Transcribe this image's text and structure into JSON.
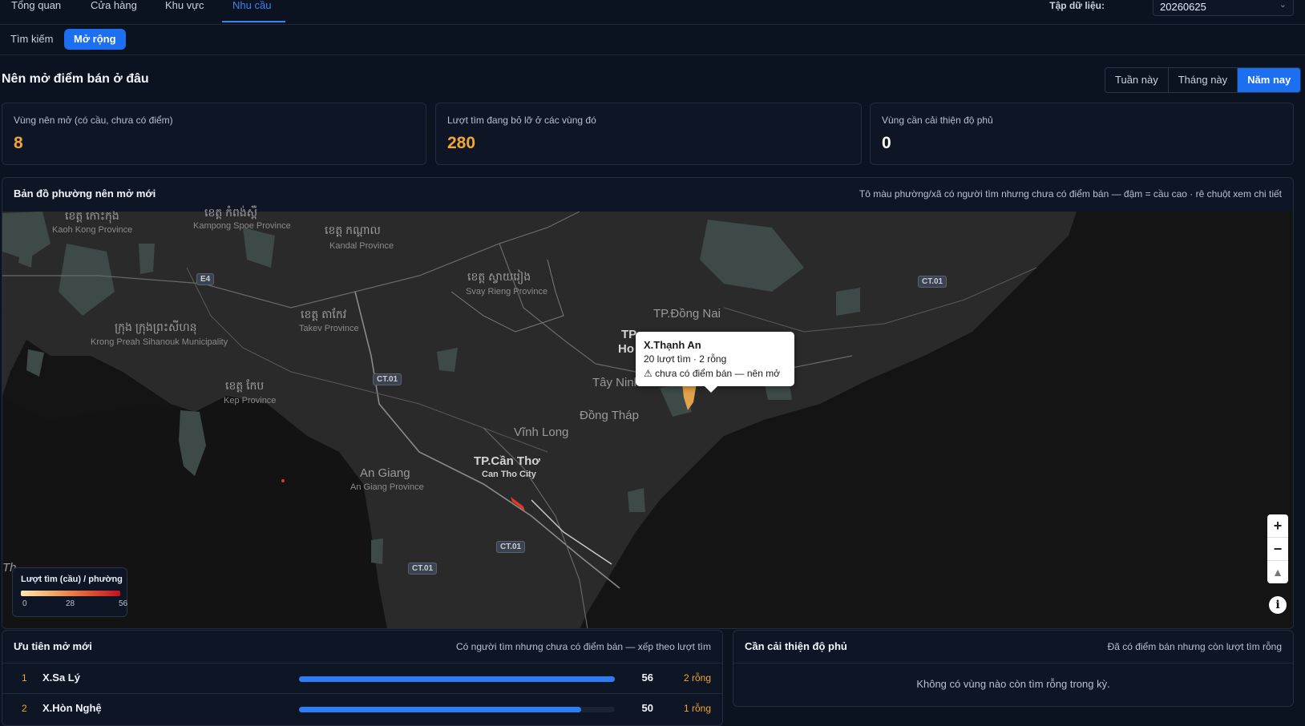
{
  "nav": {
    "tabs": [
      "Tổng quan",
      "Cửa hàng",
      "Khu vực",
      "Nhu cầu"
    ],
    "active_tab": "Nhu cầu",
    "dataset_label": "Tập dữ liệu:",
    "dataset_value": "20260625"
  },
  "subnav": {
    "tabs": [
      "Tìm kiếm",
      "Mở rộng"
    ],
    "active": "Mở rộng"
  },
  "page": {
    "title": "Nên mở điểm bán ở đâu"
  },
  "period": {
    "options": [
      "Tuần này",
      "Tháng này",
      "Năm nay"
    ],
    "active": "Năm nay"
  },
  "kpis": [
    {
      "label": "Vùng nên mở (có cầu, chưa có điểm)",
      "value": "8",
      "color": "#f0a535"
    },
    {
      "label": "Lượt tìm đang bỏ lỡ ở các vùng đó",
      "value": "280",
      "color": "#f0a535"
    },
    {
      "label": "Vùng cần cải thiện độ phủ",
      "value": "0",
      "color": "#ffffff"
    }
  ],
  "map": {
    "title": "Bản đồ phường nên mở mới",
    "hint": "Tô màu phường/xã có người tìm nhưng chưa có điểm bán — đậm = cầu cao · rê chuột xem chi tiết",
    "labels": {
      "kaoh_kong_km": "ខេត្ត កោះកុង",
      "kaoh_kong": "Kaoh Kong Province",
      "kampong_spoe_km": "ខេត្ត កំពង់ស្ពឺ",
      "kampong_spoe": "Kampong Spoe Province",
      "kandal_km": "ខេត្ត កណ្តាល",
      "kandal": "Kandal Province",
      "svay_rieng_km": "ខេត្ត ស្វាយរៀង",
      "svay_rieng": "Svay Rieng Province",
      "takeo_km": "ខេត្ត តាកែវ",
      "takeo": "Takev Province",
      "sihanouk_km": "ក្រុង ក្រុងព្រះសីហនុ",
      "sihanouk": "Krong Preah Sihanouk Municipality",
      "kep_km": "ខេត្ត កែប",
      "kep": "Kep Province",
      "dong_nai": "TP.Đồng Nai",
      "tp_partial": "TP",
      "ho_partial": "Ho",
      "tay_ninh": "Tây Ninh",
      "dong_thap": "Đồng Tháp",
      "vinh_long": "Vĩnh Long",
      "can_tho": "TP.Cần Thơ",
      "can_tho_en": "Can Tho City",
      "an_giang": "An Giang",
      "an_giang_en": "An Giang Province",
      "th_partial": "Th"
    },
    "shields": [
      "E4",
      "CT.01",
      "CT.01",
      "CT.01",
      "CT.01"
    ],
    "tooltip": {
      "name": "X.Thạnh An",
      "stats": "20 lượt tìm · 2 rỗng",
      "note": "⚠ chưa có điểm bán — nên mở"
    },
    "legend": {
      "title": "Lượt tìm (cầu) / phường",
      "min": "0",
      "mid": "28",
      "max": "56"
    },
    "controls": {
      "zoom_in": "+",
      "zoom_out": "−",
      "compass": "▲",
      "info": "i"
    }
  },
  "priority": {
    "title": "Ưu tiên mở mới",
    "hint": "Có người tìm nhưng chưa có điểm bán — xếp theo lượt tìm",
    "rows": [
      {
        "rank": "1",
        "name": "X.Sa Lý",
        "count": "56",
        "gap": "2 rỗng",
        "fraction": 1.0
      },
      {
        "rank": "2",
        "name": "X.Hòn Nghệ",
        "count": "50",
        "gap": "1 rỗng",
        "fraction": 0.893
      }
    ]
  },
  "coverage": {
    "title": "Cần cải thiện độ phủ",
    "hint": "Đã có điểm bán nhưng còn lượt tìm rỗng",
    "empty": "Không có vùng nào còn tìm rỗng trong kỳ."
  }
}
